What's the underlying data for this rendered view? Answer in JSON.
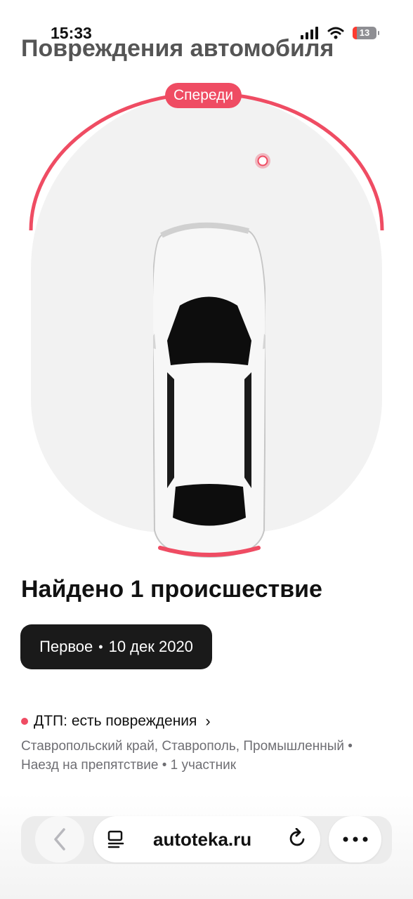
{
  "status": {
    "time": "15:33",
    "battery": "13"
  },
  "page": {
    "title": "Повреждения автомобиля"
  },
  "diagram": {
    "front_label": "Спереди"
  },
  "summary": {
    "title": "Найдено 1 происшествие",
    "chip_label": "Первое",
    "chip_separator": "•",
    "chip_date": "10 дек 2020"
  },
  "incident": {
    "title": "ДТП: есть повреждения",
    "location": "Ставропольский край, Ставрополь, Промышленный",
    "type": "Наезд на препятствие",
    "participants": "1 участник",
    "separator": "•"
  },
  "browser": {
    "url": "autoteka.ru"
  },
  "icons": {
    "signal": "cellular-signal-icon",
    "wifi": "wifi-icon",
    "back": "chevron-left-icon",
    "reader": "reader-icon",
    "reload": "reload-icon",
    "more": "more-icon",
    "damage": "damage-marker-icon"
  },
  "colors": {
    "accent": "#ef4c63",
    "chip_bg": "#1a1a1a",
    "muted_text": "#6e6e73"
  }
}
